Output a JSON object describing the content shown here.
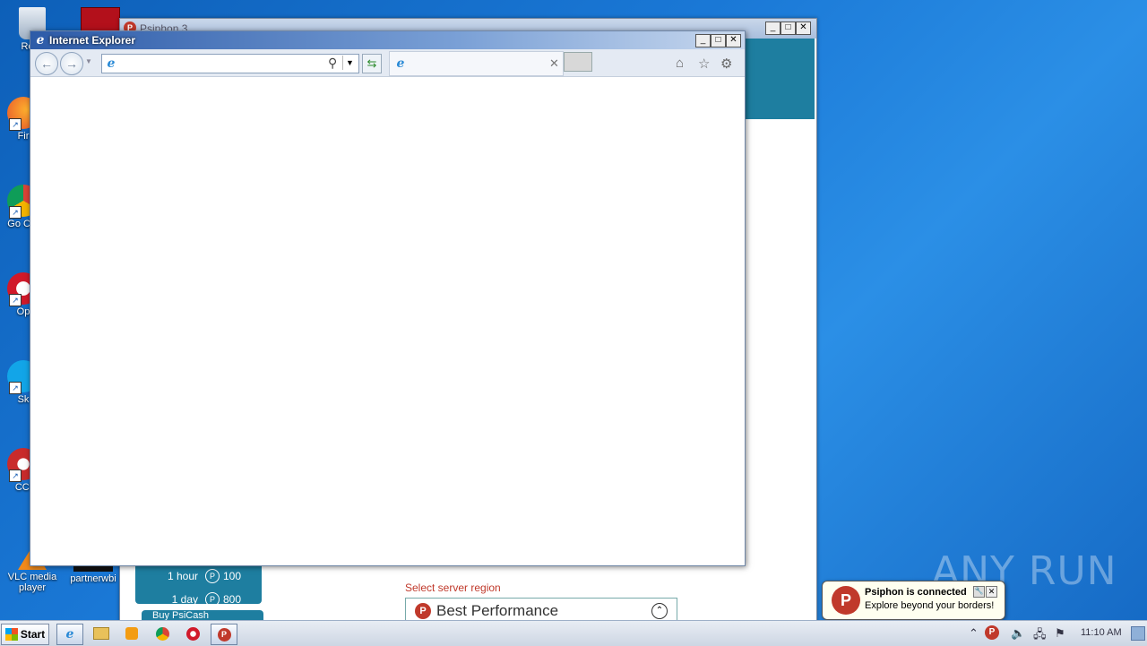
{
  "desktop": {
    "icons": [
      {
        "label": "Recy"
      },
      {
        "label": "Fir"
      },
      {
        "label": "Go Chr"
      },
      {
        "label": "Op"
      },
      {
        "label": "Sk"
      },
      {
        "label": "CCl"
      },
      {
        "label": "VLC media player"
      },
      {
        "label": "partnerwbi"
      }
    ],
    "watermark": "ANY RUN"
  },
  "psiphon": {
    "title": "Psiphon 3",
    "plans": [
      {
        "duration": "1 hour",
        "cost": "100"
      },
      {
        "duration": "1 day",
        "cost": "800"
      }
    ],
    "buy_label": "Buy PsiCash",
    "region_label": "Select server region",
    "region_value": "Best Performance",
    "colors": {
      "banner": "#1e7ea0",
      "accent": "#c0392b"
    }
  },
  "ie": {
    "title": "Internet Explorer",
    "address_value": "",
    "tab_title": "",
    "icons": [
      "back-icon",
      "forward-icon",
      "search-icon",
      "refresh-icon",
      "home-icon",
      "favorites-icon",
      "settings-icon"
    ]
  },
  "taskbar": {
    "start_label": "Start",
    "clock": "11:10 AM",
    "apps": [
      "internet-explorer",
      "file-explorer",
      "media-player",
      "chrome",
      "opera",
      "psiphon"
    ]
  },
  "notification": {
    "title": "Psiphon is connected",
    "message": "Explore beyond your borders!"
  }
}
